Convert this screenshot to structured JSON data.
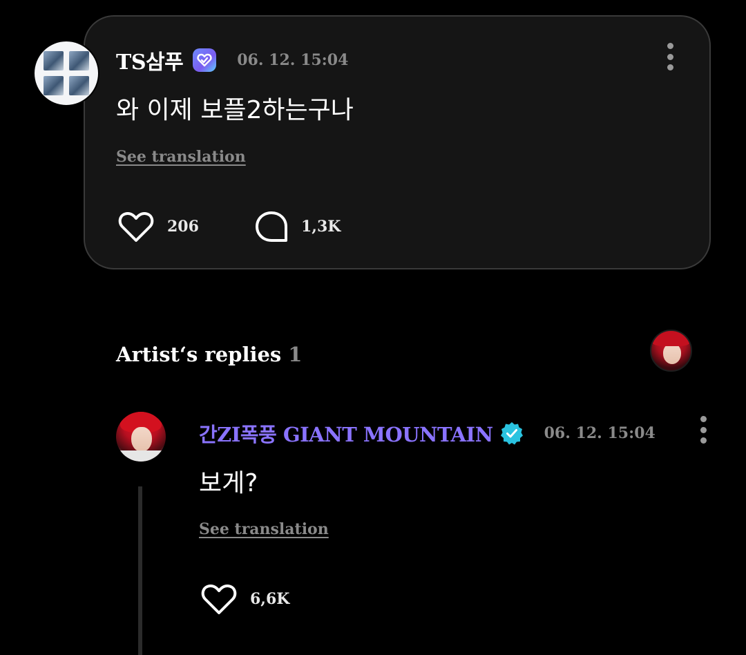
{
  "post": {
    "username": "TS삼푸",
    "timestamp": "06. 12. 15:04",
    "text": "와 이제 보플2하는구나",
    "see_translation": "See translation",
    "like_count": "206",
    "comment_count": "1,3K"
  },
  "artist_replies": {
    "title": "Artist‘s replies",
    "count": "1"
  },
  "reply": {
    "username": "간ZI폭풍 GIANT MOUNTAIN",
    "timestamp": "06. 12. 15:04",
    "text": "보게?",
    "see_translation": "See translation",
    "like_count": "6,6K"
  },
  "colors": {
    "background": "#000000",
    "card": "#151515",
    "muted_text": "#8a8a8a",
    "artist_name": "#8a73ff",
    "verify_teal": "#2ac3e0"
  },
  "icons": {
    "user_badge": "verified-blue-heart-icon",
    "artist_badge": "verified-teal-check-icon",
    "like": "heart-outline-icon",
    "comment": "speech-bubble-icon",
    "menu": "vertical-dots-icon"
  }
}
